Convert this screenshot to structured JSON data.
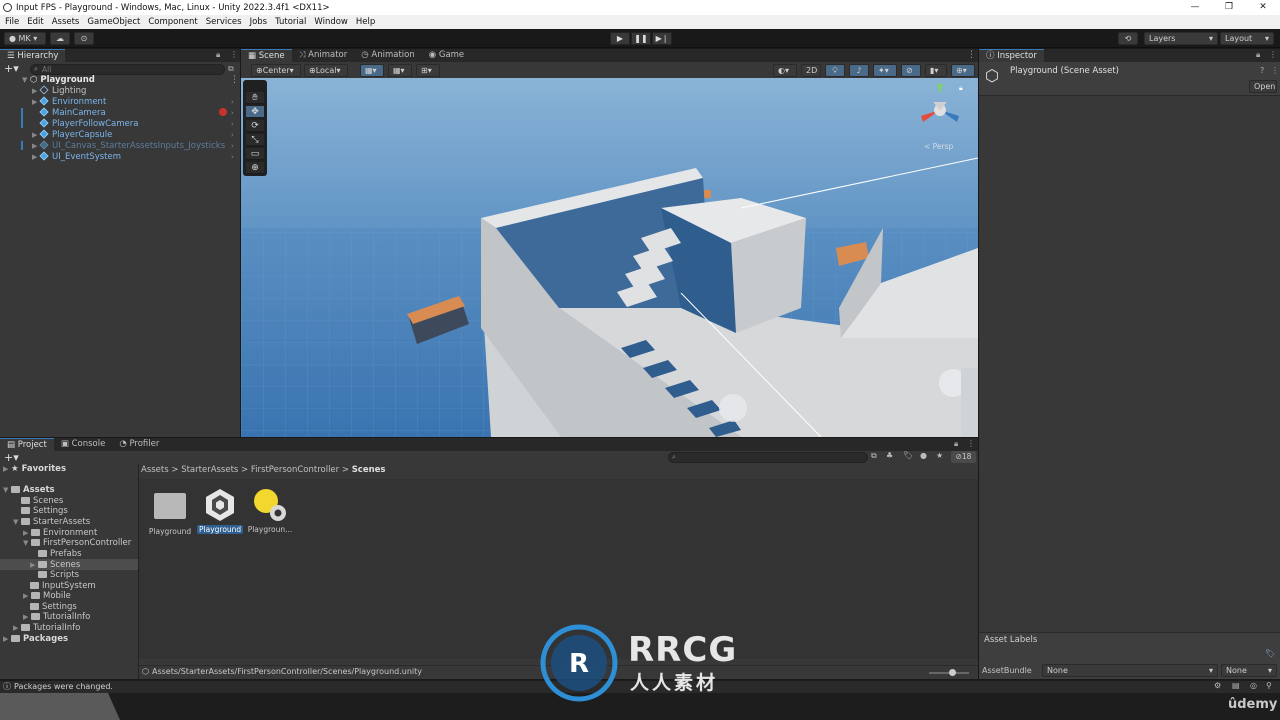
{
  "window": {
    "title": "Input FPS - Playground - Windows, Mac, Linux - Unity 2022.3.4f1 <DX11>",
    "controls": [
      "—",
      "❐",
      "✕"
    ]
  },
  "menu": [
    "File",
    "Edit",
    "Assets",
    "GameObject",
    "Component",
    "Services",
    "Jobs",
    "Tutorial",
    "Window",
    "Help"
  ],
  "toolbar": {
    "account": "MK",
    "layers": "Layers",
    "layout": "Layout"
  },
  "hierarchy": {
    "tab": "Hierarchy",
    "search_placeholder": "All",
    "scene": "Playground",
    "items": [
      {
        "label": "Lighting"
      },
      {
        "label": "Environment"
      },
      {
        "label": "MainCamera"
      },
      {
        "label": "PlayerFollowCamera"
      },
      {
        "label": "PlayerCapsule"
      },
      {
        "label": "UI_Canvas_StarterAssetsInputs_Joysticks"
      },
      {
        "label": "UI_EventSystem"
      }
    ]
  },
  "scene_view": {
    "tabs": [
      "Scene",
      "Animator",
      "Animation",
      "Game"
    ],
    "pivot": "Center",
    "space": "Local",
    "mode_2d": "2D",
    "persp": "< Persp"
  },
  "inspector": {
    "tab": "Inspector",
    "title": "Playground (Scene Asset)",
    "open_button": "Open",
    "asset_labels": "Asset Labels",
    "asset_bundle_label": "AssetBundle",
    "asset_bundle_value": "None",
    "asset_variant_value": "None"
  },
  "project": {
    "tabs": [
      "Project",
      "Console",
      "Profiler"
    ],
    "favorites": "Favorites",
    "tree": [
      {
        "label": "Assets"
      },
      {
        "label": "Scenes"
      },
      {
        "label": "Settings"
      },
      {
        "label": "StarterAssets"
      },
      {
        "label": "Environment"
      },
      {
        "label": "FirstPersonController"
      },
      {
        "label": "Prefabs"
      },
      {
        "label": "Scenes"
      },
      {
        "label": "Scripts"
      },
      {
        "label": "InputSystem"
      },
      {
        "label": "Mobile"
      },
      {
        "label": "Settings"
      },
      {
        "label": "TutorialInfo"
      },
      {
        "label": "TutorialInfo"
      },
      {
        "label": "Packages"
      }
    ],
    "breadcrumb": [
      "Assets",
      "StarterAssets",
      "FirstPersonController",
      "Scenes"
    ],
    "assets": [
      {
        "label": "Playground",
        "icon": "folder-icon"
      },
      {
        "label": "Playground",
        "icon": "unity-scene-icon"
      },
      {
        "label": "Playgroun...",
        "icon": "lighting-settings-icon"
      }
    ],
    "path": "Assets/StarterAssets/FirstPersonController/Scenes/Playground.unity",
    "hidden_count": "18"
  },
  "status": {
    "message": "Packages were changed."
  },
  "watermark": {
    "brand": "RRCG",
    "subtitle": "人人素材",
    "udemy": "ûdemy"
  },
  "colors": {
    "accent": "#3a79bb",
    "panel": "#383838",
    "sky": "#8fb6d8"
  }
}
